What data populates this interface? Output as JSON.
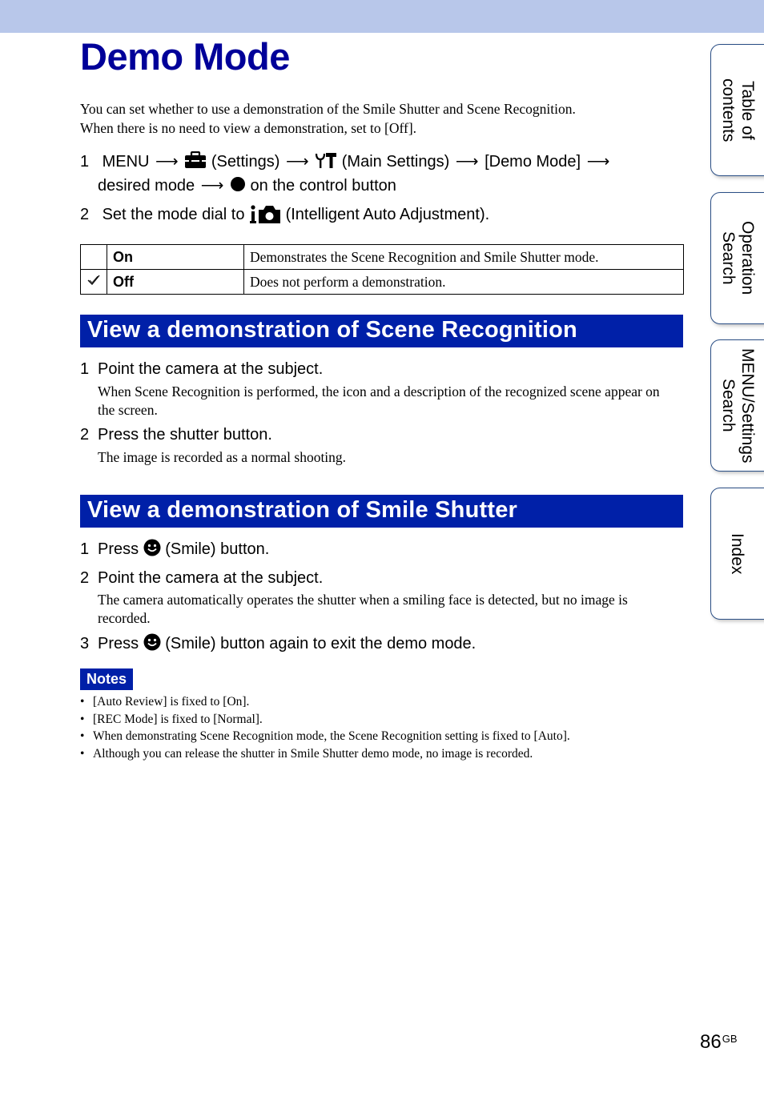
{
  "page": {
    "title": "Demo Mode",
    "intro": [
      "You can set whether to use a demonstration of the Smile Shutter and Scene Recognition.",
      "When there is no need to view a demonstration, set to [Off]."
    ],
    "page_number": "86",
    "page_suffix": "GB"
  },
  "setup_steps": [
    {
      "num": "1",
      "parts": {
        "menu": "MENU",
        "settings": "(Settings)",
        "main_settings": "(Main Settings)",
        "demo_mode": "[Demo Mode]",
        "desired_mode": "desired mode",
        "control_button": "on the control button"
      },
      "icons": [
        "arrow-icon",
        "settings-toolbox-icon",
        "main-settings-tools-icon",
        "center-button-dot-icon"
      ]
    },
    {
      "num": "2",
      "parts": {
        "before": "Set the mode dial to",
        "after": "(Intelligent Auto Adjustment)."
      },
      "icons": [
        "intelligent-auto-camera-icon"
      ]
    }
  ],
  "options_table": [
    {
      "default": false,
      "label": "On",
      "description": "Demonstrates the Scene Recognition and Smile Shutter mode."
    },
    {
      "default": true,
      "label": "Off",
      "description": "Does not perform a demonstration.",
      "marker_icon": "checkmark-icon"
    }
  ],
  "sections": [
    {
      "heading": "View a demonstration of Scene Recognition",
      "steps": [
        {
          "num": "1",
          "text": "Point the camera at the subject.",
          "detail": "When Scene Recognition is performed, the icon and a description of the recognized scene appear on the screen."
        },
        {
          "num": "2",
          "text": "Press the shutter button.",
          "detail": "The image is recorded as a normal shooting."
        }
      ]
    },
    {
      "heading": "View a demonstration of Smile Shutter",
      "steps": [
        {
          "num": "1",
          "before": "Press",
          "after": "(Smile) button.",
          "icon": "smile-icon"
        },
        {
          "num": "2",
          "text": "Point the camera at the subject.",
          "detail": "The camera automatically operates the shutter when a smiling face is detected, but no image is recorded."
        },
        {
          "num": "3",
          "before": "Press",
          "after": "(Smile) button again to exit the demo mode.",
          "icon": "smile-icon"
        }
      ]
    }
  ],
  "notes": {
    "label": "Notes",
    "items": [
      "[Auto Review] is fixed to [On].",
      "[REC Mode] is fixed to [Normal].",
      "When demonstrating Scene Recognition mode, the Scene Recognition setting is fixed to [Auto].",
      "Although you can release the shutter in Smile Shutter demo mode, no image is recorded."
    ]
  },
  "side_tabs": [
    {
      "label": "Table of\ncontents"
    },
    {
      "label": "Operation\nSearch"
    },
    {
      "label": "MENU/Settings\nSearch"
    },
    {
      "label": "Index"
    }
  ],
  "colors": {
    "title": "#000099",
    "section_bar": "#0020a8",
    "top_band": "#b8c7ea",
    "tab_border": "#2b4f86"
  }
}
